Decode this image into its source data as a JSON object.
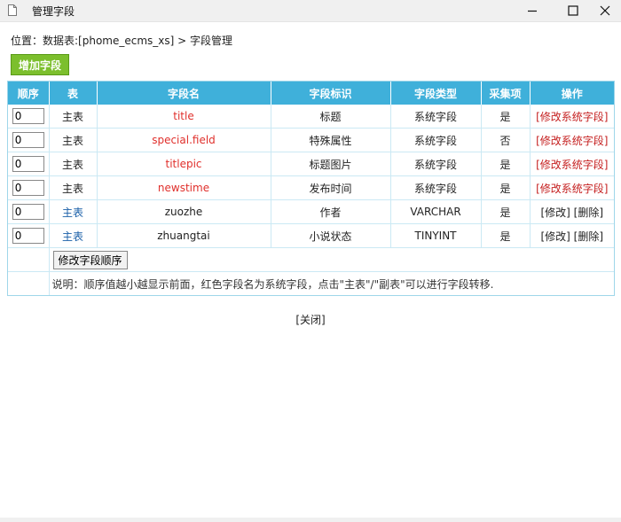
{
  "window": {
    "title": "管理字段",
    "icons": {
      "app": "document-icon",
      "minimize": "minimize-icon",
      "maximize": "maximize-icon",
      "close": "close-icon"
    }
  },
  "breadcrumb": {
    "prefix": "位置：",
    "table_link": "数据表:[phome_ecms_xs]",
    "separator": " > ",
    "current": "字段管理"
  },
  "add_button": "增加字段",
  "table": {
    "headers": [
      "顺序",
      "表",
      "字段名",
      "字段标识",
      "字段类型",
      "采集项",
      "操作"
    ],
    "rows": [
      {
        "order": "0",
        "table": "主表",
        "field": "title",
        "label": "标题",
        "type": "系统字段",
        "collect": "是",
        "op": "[修改系统字段]",
        "system": true
      },
      {
        "order": "0",
        "table": "主表",
        "field": "special.field",
        "label": "特殊属性",
        "type": "系统字段",
        "collect": "否",
        "op": "[修改系统字段]",
        "system": true
      },
      {
        "order": "0",
        "table": "主表",
        "field": "titlepic",
        "label": "标题图片",
        "type": "系统字段",
        "collect": "是",
        "op": "[修改系统字段]",
        "system": true
      },
      {
        "order": "0",
        "table": "主表",
        "field": "newstime",
        "label": "发布时间",
        "type": "系统字段",
        "collect": "是",
        "op": "[修改系统字段]",
        "system": true
      },
      {
        "order": "0",
        "table": "主表",
        "field": "zuozhe",
        "label": "作者",
        "type": "VARCHAR",
        "collect": "是",
        "op_edit": "[修改]",
        "op_delete": "[删除]",
        "system": false
      },
      {
        "order": "0",
        "table": "主表",
        "field": "zhuangtai",
        "label": "小说状态",
        "type": "TINYINT",
        "collect": "是",
        "op_edit": "[修改]",
        "op_delete": "[删除]",
        "system": false
      }
    ],
    "order_button": "修改字段顺序",
    "note": "说明：顺序值越小越显示前面，红色字段名为系统字段，点击\"主表\"/\"副表\"可以进行字段转移."
  },
  "close_link": "[关闭]",
  "colors": {
    "header_bg": "#3fb0da",
    "system_field": "#e0302c",
    "add_button_bg": "#7cbf2d",
    "border": "#9fd6ea"
  }
}
